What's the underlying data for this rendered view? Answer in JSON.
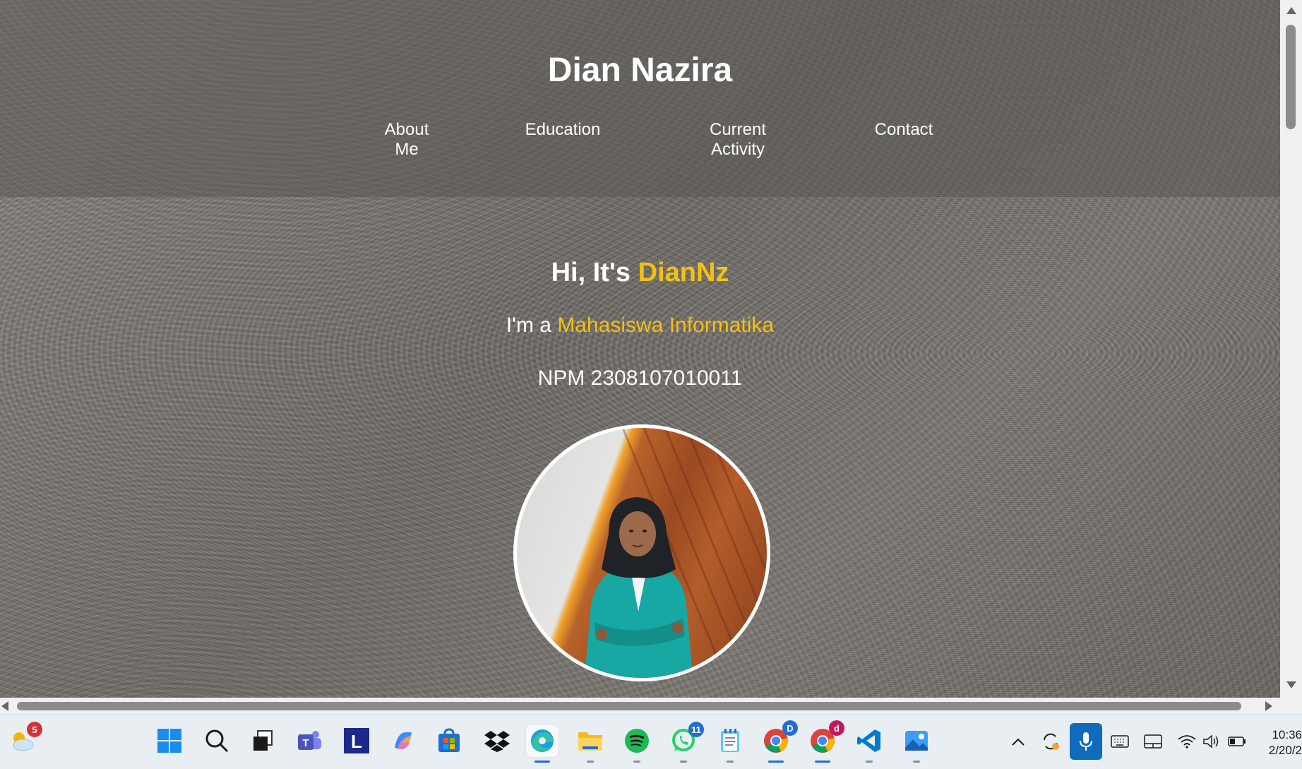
{
  "site": {
    "title": "Dian Nazira",
    "nav": [
      {
        "line1": "About",
        "line2": "Me"
      },
      {
        "line1": "Education",
        "line2": ""
      },
      {
        "line1": "Current",
        "line2": "Activity"
      },
      {
        "line1": "Contact",
        "line2": ""
      }
    ]
  },
  "hero": {
    "greeting_prefix": "Hi, It's ",
    "greeting_name": "DianNz",
    "role_prefix": "I'm a ",
    "role_value": "Mahasiswa Informatika",
    "npm": "NPM 2308107010011"
  },
  "colors": {
    "accent": "#f2c114",
    "header_overlay": "rgba(90,88,84,0.55)",
    "text": "#ffffff"
  },
  "taskbar": {
    "weather_badge": "5",
    "whatsapp_badge": "11",
    "chrome_profile_1": "D",
    "chrome_profile_2": "d",
    "icons": [
      "weather-icon",
      "start-icon",
      "search-icon",
      "task-view-icon",
      "teams-icon",
      "l-app-icon",
      "copilot-icon",
      "store-icon",
      "dropbox-icon",
      "edge-icon",
      "file-explorer-icon",
      "spotify-icon",
      "whatsapp-icon",
      "notepad-icon",
      "chrome-icon",
      "chrome-icon",
      "vscode-icon",
      "photos-icon"
    ],
    "clock_time": "10:36",
    "clock_date": "2/20/2"
  }
}
